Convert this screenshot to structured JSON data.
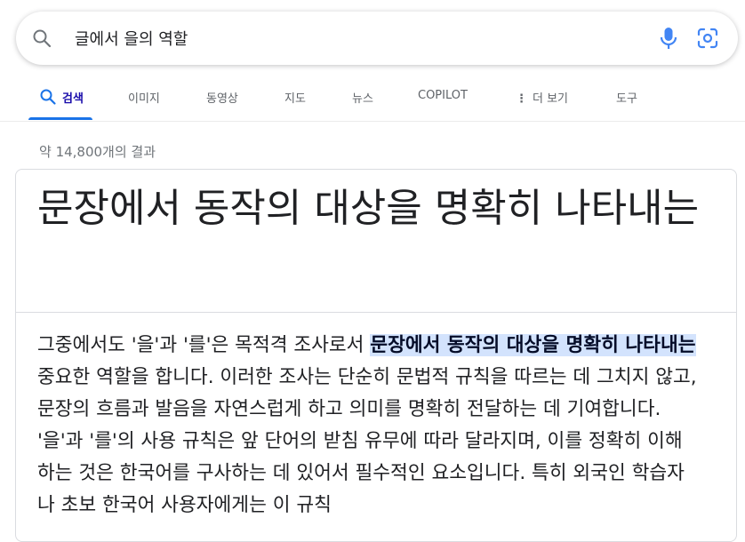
{
  "search": {
    "query": "글에서 을의 역할"
  },
  "tabs": [
    {
      "label": "검색",
      "active": true
    },
    {
      "label": "이미지"
    },
    {
      "label": "동영상"
    },
    {
      "label": "지도"
    },
    {
      "label": "뉴스"
    },
    {
      "label": "COPILOT"
    },
    {
      "label": "더 보기"
    },
    {
      "label": "도구"
    }
  ],
  "results": {
    "stats": "약 14,800개의 결과"
  },
  "featured_snippet": {
    "title": "문장에서 동작의 대상을 명확히 나타내는",
    "body_before": "그중에서도 '을'과 '를'은 목적격 조사로서 ",
    "body_highlight": "문장에서 동작의 대상을 명확히 나타내는",
    "body_after": " 중요한 역할을 합니다. 이러한 조사는 단순히 문법적 규칙을 따르는 데 그치지 않고, 문장의 흐름과 발음을 자연스럽게 하고 의미를 명확히 전달하는 데 기여합니다. '을'과 '를'의 사용 규칙은 앞 단어의 받침 유무에 따라 달라지며, 이를 정확히 이해하는 것은 한국어를 구사하는 데 있어서 필수적인 요소입니다. 특히 외국인 학습자나 초보 한국어 사용자에게는 이 규칙"
  },
  "colors": {
    "link_blue": "#1a0dab",
    "accent_blue": "#1a73e8",
    "highlight_bg": "#d3e3fd",
    "muted_text": "#70757a"
  }
}
